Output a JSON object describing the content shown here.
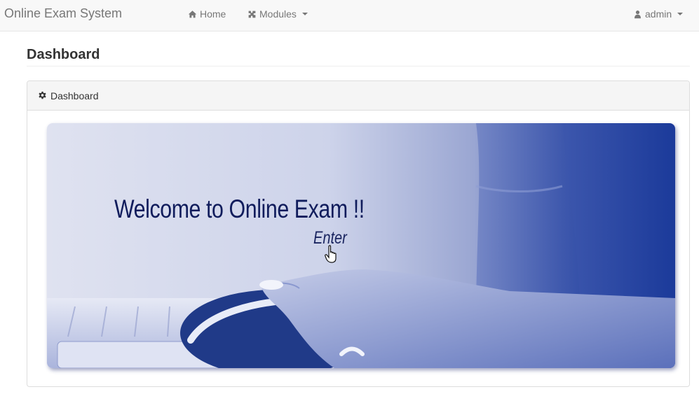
{
  "app": {
    "title": "Online Exam System"
  },
  "nav": {
    "home": {
      "label": "Home",
      "icon": "home-icon"
    },
    "modules": {
      "label": "Modules",
      "icon": "puzzle-icon"
    },
    "user": {
      "label": "admin",
      "icon": "user-icon"
    }
  },
  "page": {
    "title": "Dashboard"
  },
  "panel": {
    "heading": "Dashboard",
    "icon": "gear-icon"
  },
  "banner": {
    "welcome_text": "Welcome to Online Exam !!",
    "enter_text": "Enter"
  },
  "colors": {
    "navbar_bg": "#f8f8f8",
    "banner_blue": "#1b3a9a",
    "banner_text": "#101c5c"
  }
}
